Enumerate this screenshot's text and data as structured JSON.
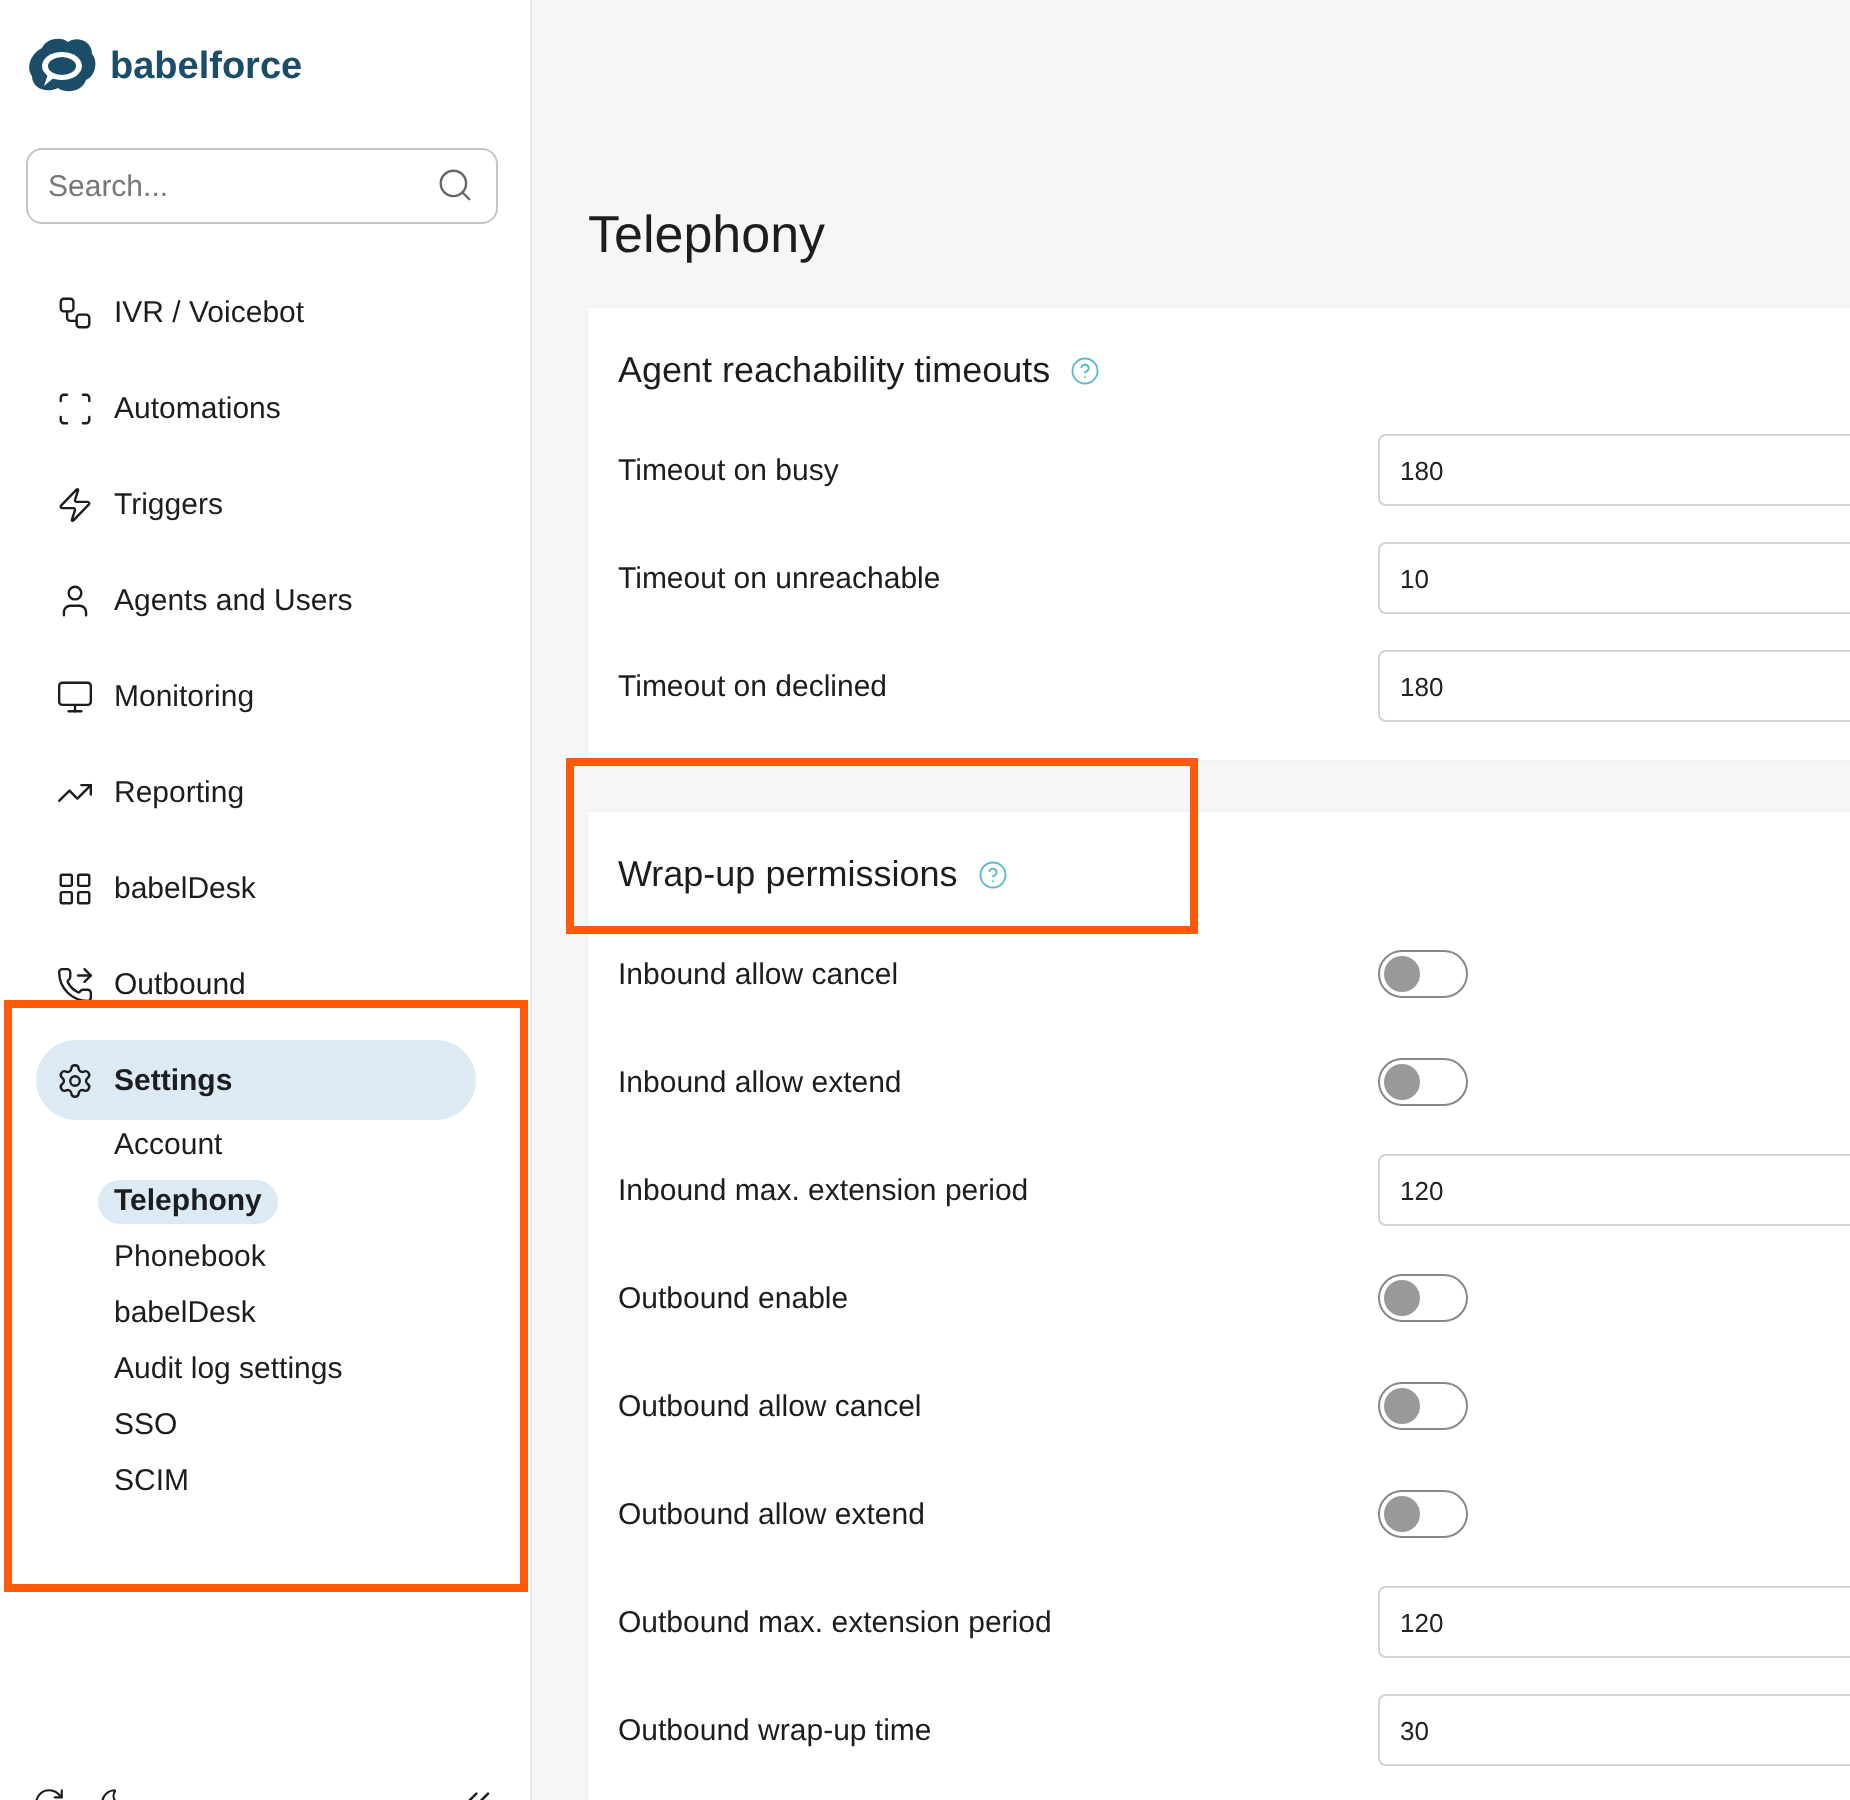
{
  "brand": {
    "name": "babelforce"
  },
  "search": {
    "placeholder": "Search..."
  },
  "nav": [
    {
      "label": "IVR / Voicebot",
      "selected": false
    },
    {
      "label": "Automations",
      "selected": false
    },
    {
      "label": "Triggers",
      "selected": false
    },
    {
      "label": "Agents and Users",
      "selected": false
    },
    {
      "label": "Monitoring",
      "selected": false
    },
    {
      "label": "Reporting",
      "selected": false
    },
    {
      "label": "babelDesk",
      "selected": false
    },
    {
      "label": "Outbound",
      "selected": false
    },
    {
      "label": "Settings",
      "selected": true,
      "children": [
        {
          "label": "Account",
          "selected": false
        },
        {
          "label": "Telephony",
          "selected": true
        },
        {
          "label": "Phonebook",
          "selected": false
        },
        {
          "label": "babelDesk",
          "selected": false
        },
        {
          "label": "Audit log settings",
          "selected": false
        },
        {
          "label": "SSO",
          "selected": false
        },
        {
          "label": "SCIM",
          "selected": false
        }
      ]
    }
  ],
  "page": {
    "title": "Telephony"
  },
  "sections": [
    {
      "title": "Agent reachability timeouts",
      "rows": [
        {
          "kind": "number",
          "label": "Timeout on busy",
          "value": "180"
        },
        {
          "kind": "number",
          "label": "Timeout on unreachable",
          "value": "10"
        },
        {
          "kind": "number",
          "label": "Timeout on declined",
          "value": "180"
        }
      ]
    },
    {
      "title": "Wrap-up permissions",
      "rows": [
        {
          "kind": "toggle",
          "label": "Inbound allow cancel",
          "on": false
        },
        {
          "kind": "toggle",
          "label": "Inbound allow extend",
          "on": false
        },
        {
          "kind": "number",
          "label": "Inbound max. extension period",
          "value": "120"
        },
        {
          "kind": "toggle",
          "label": "Outbound enable",
          "on": false
        },
        {
          "kind": "toggle",
          "label": "Outbound allow cancel",
          "on": false
        },
        {
          "kind": "toggle",
          "label": "Outbound allow extend",
          "on": false
        },
        {
          "kind": "number",
          "label": "Outbound max. extension period",
          "value": "120"
        },
        {
          "kind": "number",
          "label": "Outbound wrap-up time",
          "value": "30"
        }
      ]
    }
  ]
}
